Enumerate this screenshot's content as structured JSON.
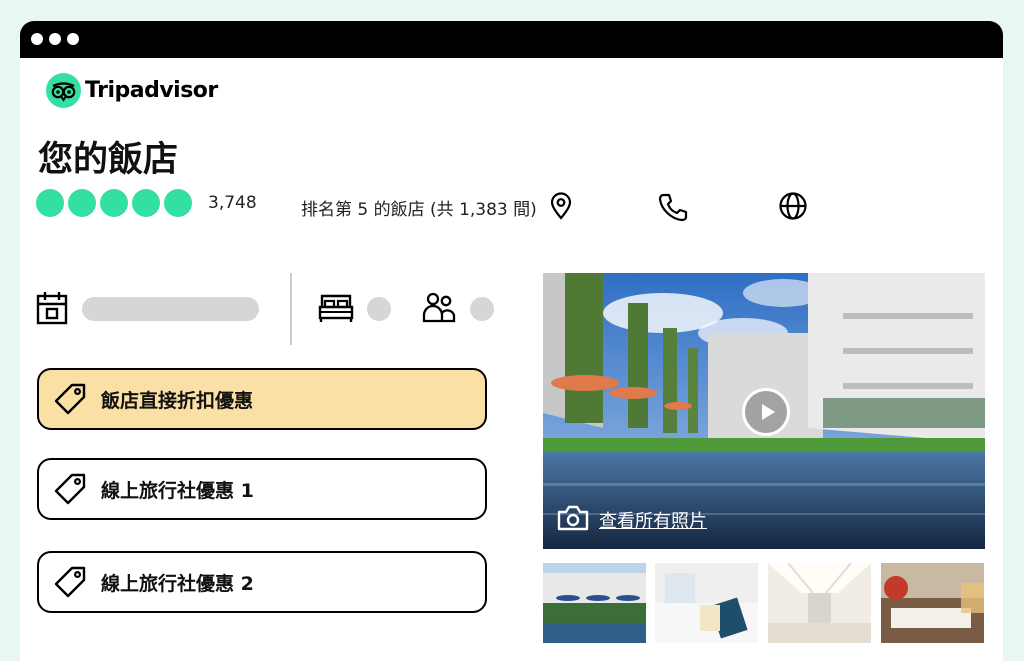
{
  "brand": {
    "name": "Tripadvisor",
    "color": "#34e0a1"
  },
  "hotel": {
    "name": "您的飯店",
    "rating_bubbles": 5,
    "review_count": "3,748",
    "rank_text": "排名第 5 的飯店 (共 1,383 間)"
  },
  "icons": {
    "location": "map-pin-icon",
    "phone": "phone-icon",
    "website": "globe-icon",
    "calendar": "calendar-icon",
    "rooms": "bed-icon",
    "guests": "people-icon",
    "deal": "price-tag-icon",
    "camera": "camera-icon",
    "play": "play-icon"
  },
  "deals": [
    {
      "label": "飯店直接折扣優惠",
      "highlight": true
    },
    {
      "label": "線上旅行社優惠 1",
      "highlight": false
    },
    {
      "label": "線上旅行社優惠 2",
      "highlight": false
    }
  ],
  "photos": {
    "see_all_label": "查看所有照片"
  },
  "colors": {
    "deal_highlight": "#fbe0a6",
    "placeholder": "#d6d6d6"
  }
}
